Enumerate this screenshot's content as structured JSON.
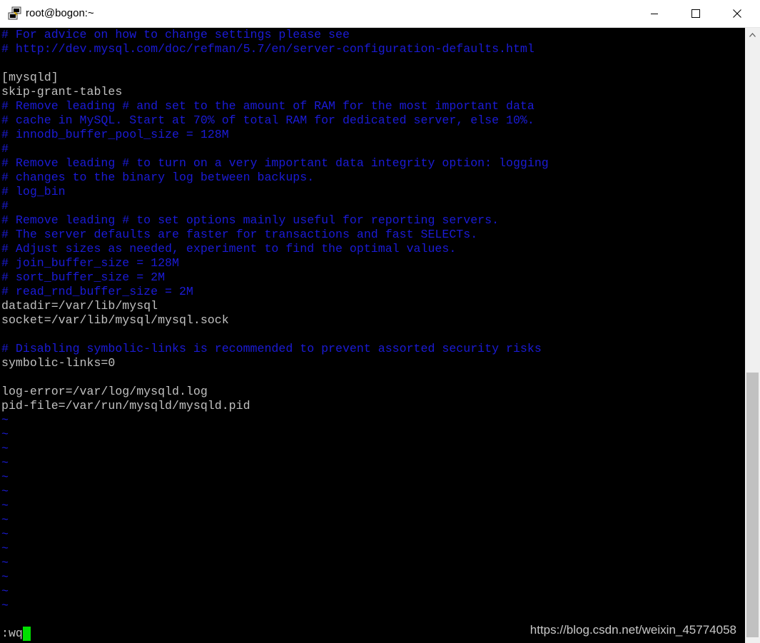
{
  "window": {
    "title": "root@bogon:~",
    "icon": "putty-icon",
    "controls": [
      "minimize-icon",
      "maximize-icon",
      "close-icon"
    ]
  },
  "terminal": {
    "colors": {
      "background": "#000000",
      "text": "#c0c0c0",
      "comment": "#1b1bd6",
      "cursor": "#00e000"
    },
    "lines": [
      {
        "type": "comment",
        "text": "# For advice on how to change settings please see"
      },
      {
        "type": "comment",
        "text": "# http://dev.mysql.com/doc/refman/5.7/en/server-configuration-defaults.html"
      },
      {
        "type": "text",
        "text": ""
      },
      {
        "type": "text",
        "text": "[mysqld]"
      },
      {
        "type": "text",
        "text": "skip-grant-tables"
      },
      {
        "type": "comment",
        "text": "# Remove leading # and set to the amount of RAM for the most important data"
      },
      {
        "type": "comment",
        "text": "# cache in MySQL. Start at 70% of total RAM for dedicated server, else 10%."
      },
      {
        "type": "comment",
        "text": "# innodb_buffer_pool_size = 128M"
      },
      {
        "type": "comment",
        "text": "#"
      },
      {
        "type": "comment",
        "text": "# Remove leading # to turn on a very important data integrity option: logging"
      },
      {
        "type": "comment",
        "text": "# changes to the binary log between backups."
      },
      {
        "type": "comment",
        "text": "# log_bin"
      },
      {
        "type": "comment",
        "text": "#"
      },
      {
        "type": "comment",
        "text": "# Remove leading # to set options mainly useful for reporting servers."
      },
      {
        "type": "comment",
        "text": "# The server defaults are faster for transactions and fast SELECTs."
      },
      {
        "type": "comment",
        "text": "# Adjust sizes as needed, experiment to find the optimal values."
      },
      {
        "type": "comment",
        "text": "# join_buffer_size = 128M"
      },
      {
        "type": "comment",
        "text": "# sort_buffer_size = 2M"
      },
      {
        "type": "comment",
        "text": "# read_rnd_buffer_size = 2M"
      },
      {
        "type": "text",
        "text": "datadir=/var/lib/mysql"
      },
      {
        "type": "text",
        "text": "socket=/var/lib/mysql/mysql.sock"
      },
      {
        "type": "text",
        "text": ""
      },
      {
        "type": "comment",
        "text": "# Disabling symbolic-links is recommended to prevent assorted security risks"
      },
      {
        "type": "text",
        "text": "symbolic-links=0"
      },
      {
        "type": "text",
        "text": ""
      },
      {
        "type": "text",
        "text": "log-error=/var/log/mysqld.log"
      },
      {
        "type": "text",
        "text": "pid-file=/var/run/mysqld/mysqld.pid"
      },
      {
        "type": "tilde",
        "text": "~"
      },
      {
        "type": "tilde",
        "text": "~"
      },
      {
        "type": "tilde",
        "text": "~"
      },
      {
        "type": "tilde",
        "text": "~"
      },
      {
        "type": "tilde",
        "text": "~"
      },
      {
        "type": "tilde",
        "text": "~"
      },
      {
        "type": "tilde",
        "text": "~"
      },
      {
        "type": "tilde",
        "text": "~"
      },
      {
        "type": "tilde",
        "text": "~"
      },
      {
        "type": "tilde",
        "text": "~"
      },
      {
        "type": "tilde",
        "text": "~"
      },
      {
        "type": "tilde",
        "text": "~"
      },
      {
        "type": "tilde",
        "text": "~"
      },
      {
        "type": "tilde",
        "text": "~"
      }
    ],
    "command_line": ":wq"
  },
  "watermark": "https://blog.csdn.net/weixin_45774058",
  "scrollbar": {
    "thumb_start_fraction": 0.55,
    "thumb_size_fraction": 0.44
  }
}
